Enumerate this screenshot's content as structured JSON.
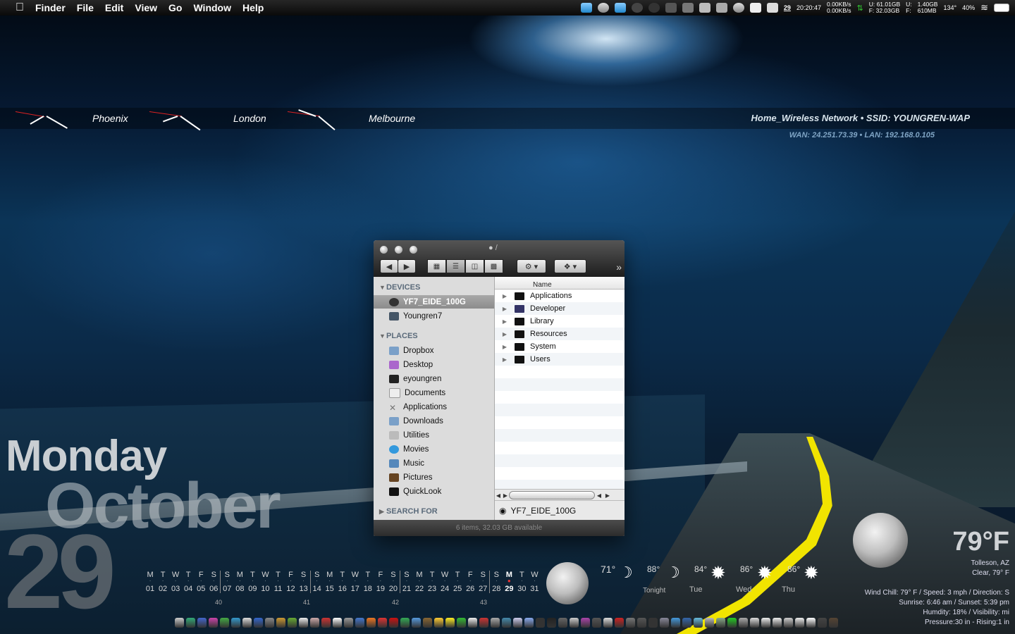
{
  "menubar": {
    "app_name": "Finder",
    "items": [
      "File",
      "Edit",
      "View",
      "Go",
      "Window",
      "Help"
    ],
    "date_badge": "29",
    "time": "20:20:47",
    "net_up": "0.00KB/s",
    "net_down": "0.00KB/s",
    "disk_u": "U: 61.01GB",
    "disk_f": "F: 32.03GB",
    "mem_u": "1.40GB",
    "mem_f": "610MB",
    "mem_u_label": "U:",
    "mem_f_label": "F:",
    "temp": "134°",
    "battery": "40%"
  },
  "world_clocks": [
    "Phoenix",
    "London",
    "Melbourne"
  ],
  "network": {
    "line1": "Home_Wireless Network • SSID: YOUNGREN-WAP",
    "line2": "WAN: 24.251.73.39 • LAN: 192.168.0.105"
  },
  "date_widget": {
    "day": "Monday",
    "month": "October",
    "date": "29"
  },
  "calendar": {
    "letters": [
      "M",
      "T",
      "W",
      "T",
      "F",
      "S",
      "S",
      "M",
      "T",
      "W",
      "T",
      "F",
      "S",
      "S",
      "M",
      "T",
      "W",
      "T",
      "F",
      "S",
      "S",
      "M",
      "T",
      "W",
      "T",
      "F",
      "S",
      "S",
      "M",
      "T",
      "W"
    ],
    "numbers": [
      "01",
      "02",
      "03",
      "04",
      "05",
      "06",
      "07",
      "08",
      "09",
      "10",
      "11",
      "12",
      "13",
      "14",
      "15",
      "16",
      "17",
      "18",
      "19",
      "20",
      "21",
      "22",
      "23",
      "24",
      "25",
      "26",
      "27",
      "28",
      "29",
      "30",
      "31"
    ],
    "weeks": [
      "40",
      "41",
      "42",
      "43"
    ],
    "today_index": 28
  },
  "forecast": {
    "current": "71°",
    "tonight_high": "88°",
    "tonight_label": "Tonight",
    "tue": "84°",
    "tue_label": "Tue",
    "wed": "86°",
    "wed_label": "Wed",
    "thu": "86°",
    "thu_label": "Thu"
  },
  "weather": {
    "temp": "79°F",
    "location": "Tolleson, AZ",
    "condition": "Clear, 79° F",
    "wind": "Wind Chill: 79° F / Speed: 3 mph / Direction: S",
    "sun": "Sunrise: 6:46 am / Sunset: 5:39 pm",
    "humidity": "Humdity: 18% / Visibility: mi",
    "pressure": "Pressure:30 in - Rising:1 in"
  },
  "finder": {
    "title": "/",
    "sections": {
      "devices": "DEVICES",
      "places": "PLACES",
      "search": "SEARCH FOR"
    },
    "devices": [
      "YF7_EIDE_100G",
      "Youngren7"
    ],
    "places": [
      "Dropbox",
      "Desktop",
      "eyoungren",
      "Documents",
      "Applications",
      "Downloads",
      "Utilities",
      "Movies",
      "Music",
      "Pictures",
      "QuickLook"
    ],
    "column_name": "Name",
    "files": [
      "Applications",
      "Developer",
      "Library",
      "Resources",
      "System",
      "Users"
    ],
    "path": "YF7_EIDE_100G",
    "status": "6 items, 32.03 GB available"
  },
  "colors": {
    "accent_yellow": "#f1e400",
    "calendar_today": "#e33333"
  }
}
